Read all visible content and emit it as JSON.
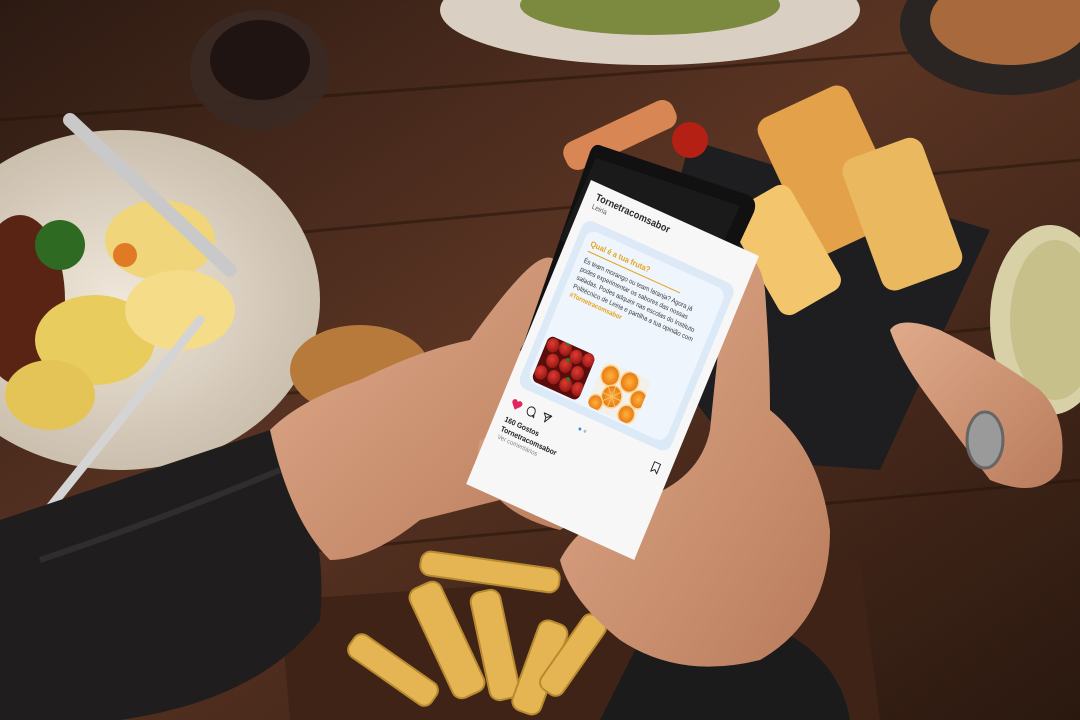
{
  "post": {
    "account": "Tornetracomsabor",
    "location": "Leiria",
    "question": "Qual é a tua fruta?",
    "body_text": "És team morango ou team laranja? Agora já podes experimentar os sabores das nossas saladas. Podes adquirir nas escolas do Instituto Politécnico de Leiria e partilha a tua opinião com",
    "hashtag": "#Tornetracomsabor",
    "likes": "160 Gostos",
    "caption_user": "Tornetracomsabor",
    "more_text": "Ver comentários"
  },
  "icons": [
    "heart-icon",
    "comment-icon",
    "share-icon",
    "bookmark-icon"
  ],
  "colors": {
    "accent": "#e7a21a",
    "card": "#dce9f7",
    "like": "#e0245e"
  }
}
